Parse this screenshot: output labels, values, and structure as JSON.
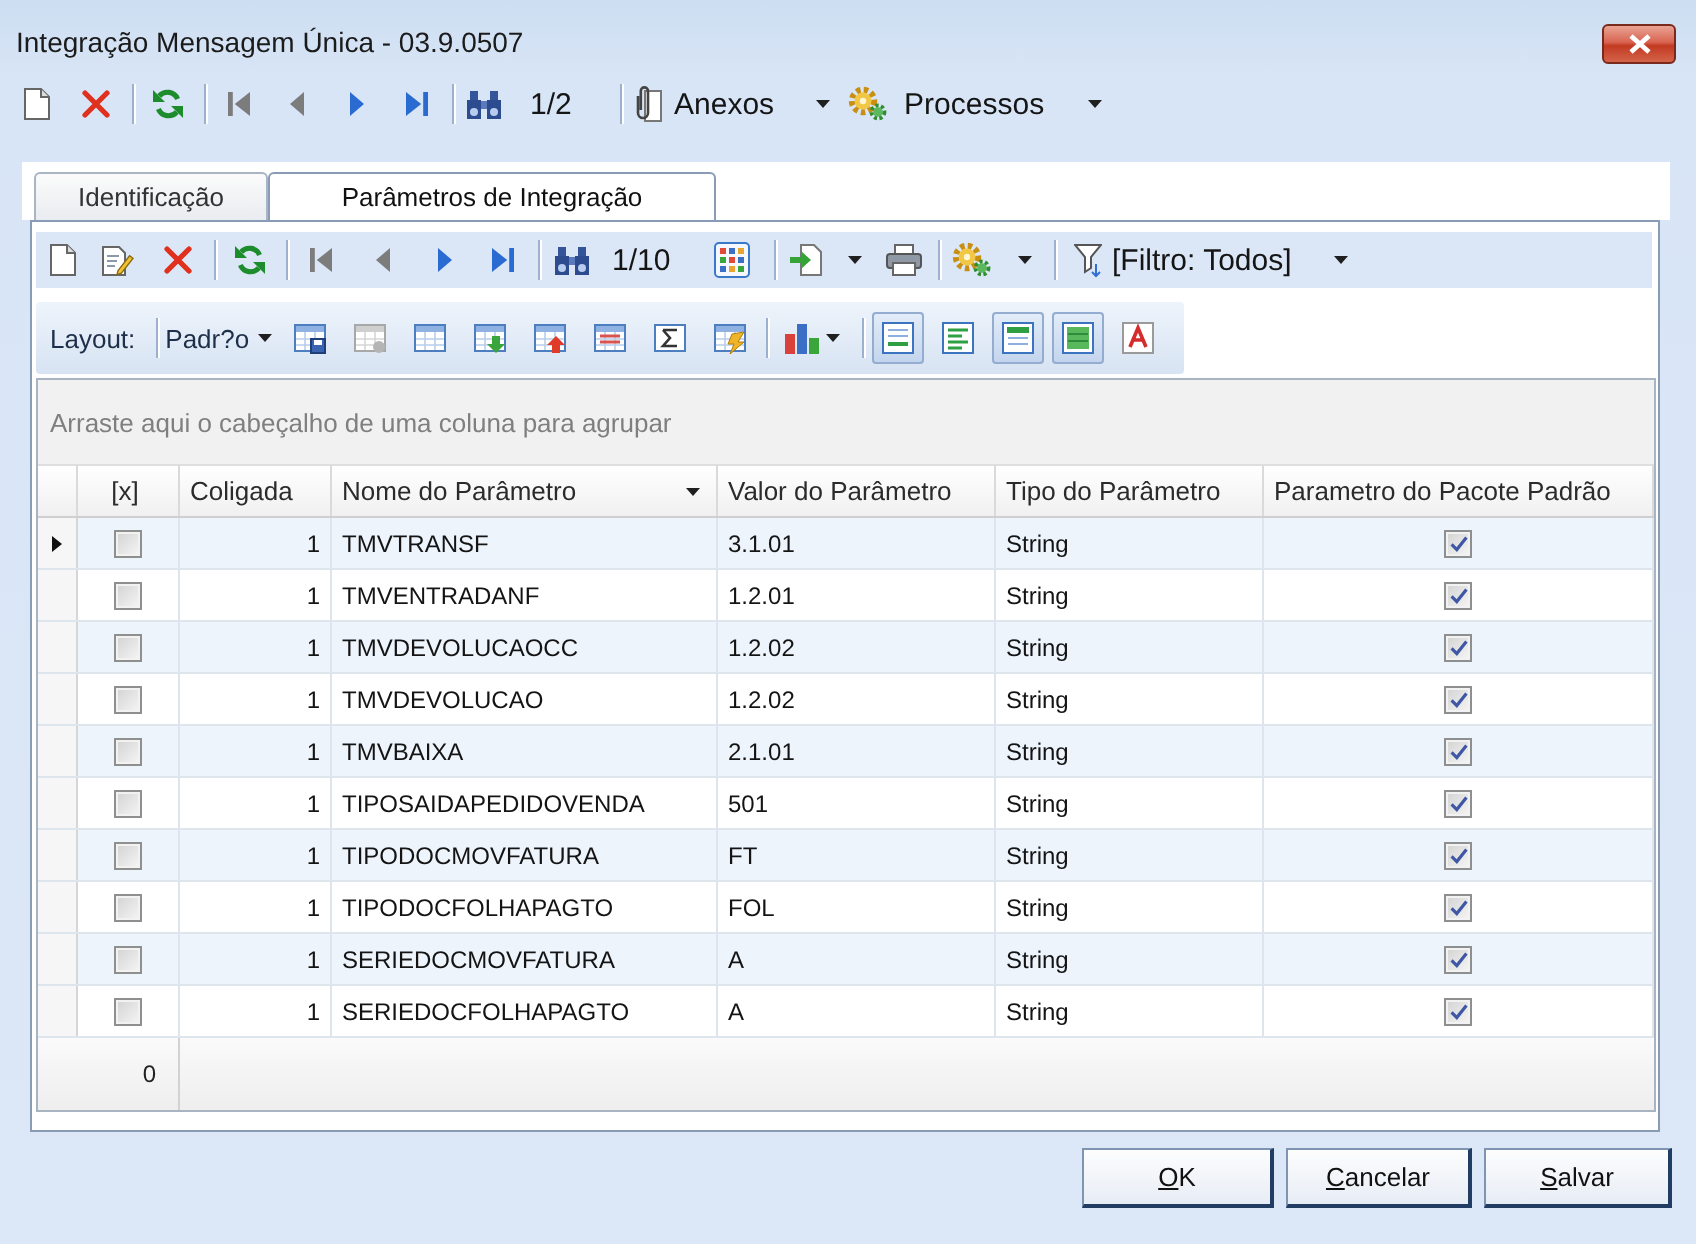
{
  "window": {
    "title": "Integração Mensagem Única - 03.9.0507"
  },
  "toolbar": {
    "nav": [
      {
        "kind": "first",
        "disabled": true
      },
      {
        "kind": "previous",
        "disabled": true
      },
      {
        "kind": "next",
        "disabled": false
      },
      {
        "kind": "last",
        "disabled": false
      }
    ],
    "record_counter": "1/2",
    "attachments": "Anexos",
    "processes": "Processos"
  },
  "tabs": [
    {
      "label": "Identificação",
      "selected": false
    },
    {
      "label": "Parâmetros de Integração",
      "selected": true
    }
  ],
  "record_toolbar": {
    "nav": [
      {
        "kind": "first",
        "disabled": true
      },
      {
        "kind": "previous",
        "disabled": true
      },
      {
        "kind": "next",
        "disabled": false
      },
      {
        "kind": "last",
        "disabled": false
      }
    ],
    "record_counter": "1/10",
    "filter": "[Filtro: Todos]"
  },
  "layout_toolbar": {
    "label": "Layout:",
    "layout": "Padr?o",
    "tools": [
      {
        "kind": "save",
        "disabled": false
      },
      {
        "kind": "remove",
        "disabled": true
      },
      {
        "kind": "columns",
        "disabled": false
      },
      {
        "kind": "import",
        "disabled": false
      },
      {
        "kind": "export",
        "disabled": false
      },
      {
        "kind": "rows",
        "disabled": false
      },
      {
        "kind": "sum",
        "disabled": false
      },
      {
        "kind": "edit",
        "disabled": false
      }
    ],
    "toggles": [
      {
        "kind": "bars",
        "on": true
      },
      {
        "kind": "stripes",
        "on": false
      },
      {
        "kind": "frame",
        "on": true
      },
      {
        "kind": "fill",
        "on": true
      }
    ]
  },
  "group_panel": {
    "hint": "Arraste aqui o cabeçalho de uma coluna para agrupar"
  },
  "grid": {
    "columns": [
      {
        "label": "[x]",
        "menu": false
      },
      {
        "label": "Coligada",
        "menu": false
      },
      {
        "label": "Nome do Parâmetro",
        "menu": true
      },
      {
        "label": "Valor do Parâmetro",
        "menu": false
      },
      {
        "label": "Tipo do Parâmetro",
        "menu": false
      },
      {
        "label": "Parametro do Pacote Padrão",
        "menu": false
      }
    ],
    "rows": [
      {
        "current": true,
        "checked": false,
        "coligada": "1",
        "name": "TMVTRANSF",
        "value": "3.1.01",
        "type": "String",
        "default_package": true
      },
      {
        "current": false,
        "checked": false,
        "coligada": "1",
        "name": "TMVENTRADANF",
        "value": "1.2.01",
        "type": "String",
        "default_package": true
      },
      {
        "current": false,
        "checked": false,
        "coligada": "1",
        "name": "TMVDEVOLUCAOCC",
        "value": "1.2.02",
        "type": "String",
        "default_package": true
      },
      {
        "current": false,
        "checked": false,
        "coligada": "1",
        "name": "TMVDEVOLUCAO",
        "value": "1.2.02",
        "type": "String",
        "default_package": true
      },
      {
        "current": false,
        "checked": false,
        "coligada": "1",
        "name": "TMVBAIXA",
        "value": "2.1.01",
        "type": "String",
        "default_package": true
      },
      {
        "current": false,
        "checked": false,
        "coligada": "1",
        "name": "TIPOSAIDAPEDIDOVENDA",
        "value": "501",
        "type": "String",
        "default_package": true
      },
      {
        "current": false,
        "checked": false,
        "coligada": "1",
        "name": "TIPODOCMOVFATURA",
        "value": "FT",
        "type": "String",
        "default_package": true
      },
      {
        "current": false,
        "checked": false,
        "coligada": "1",
        "name": "TIPODOCFOLHAPAGTO",
        "value": "FOL",
        "type": "String",
        "default_package": true
      },
      {
        "current": false,
        "checked": false,
        "coligada": "1",
        "name": "SERIEDOCMOVFATURA",
        "value": "A",
        "type": "String",
        "default_package": true
      },
      {
        "current": false,
        "checked": false,
        "coligada": "1",
        "name": "SERIEDOCFOLHAPAGTO",
        "value": "A",
        "type": "String",
        "default_package": true
      }
    ],
    "footer": {
      "count": "0"
    }
  },
  "buttons": [
    {
      "label": "OK"
    },
    {
      "label": "Cancelar"
    },
    {
      "label": "Salvar"
    }
  ]
}
